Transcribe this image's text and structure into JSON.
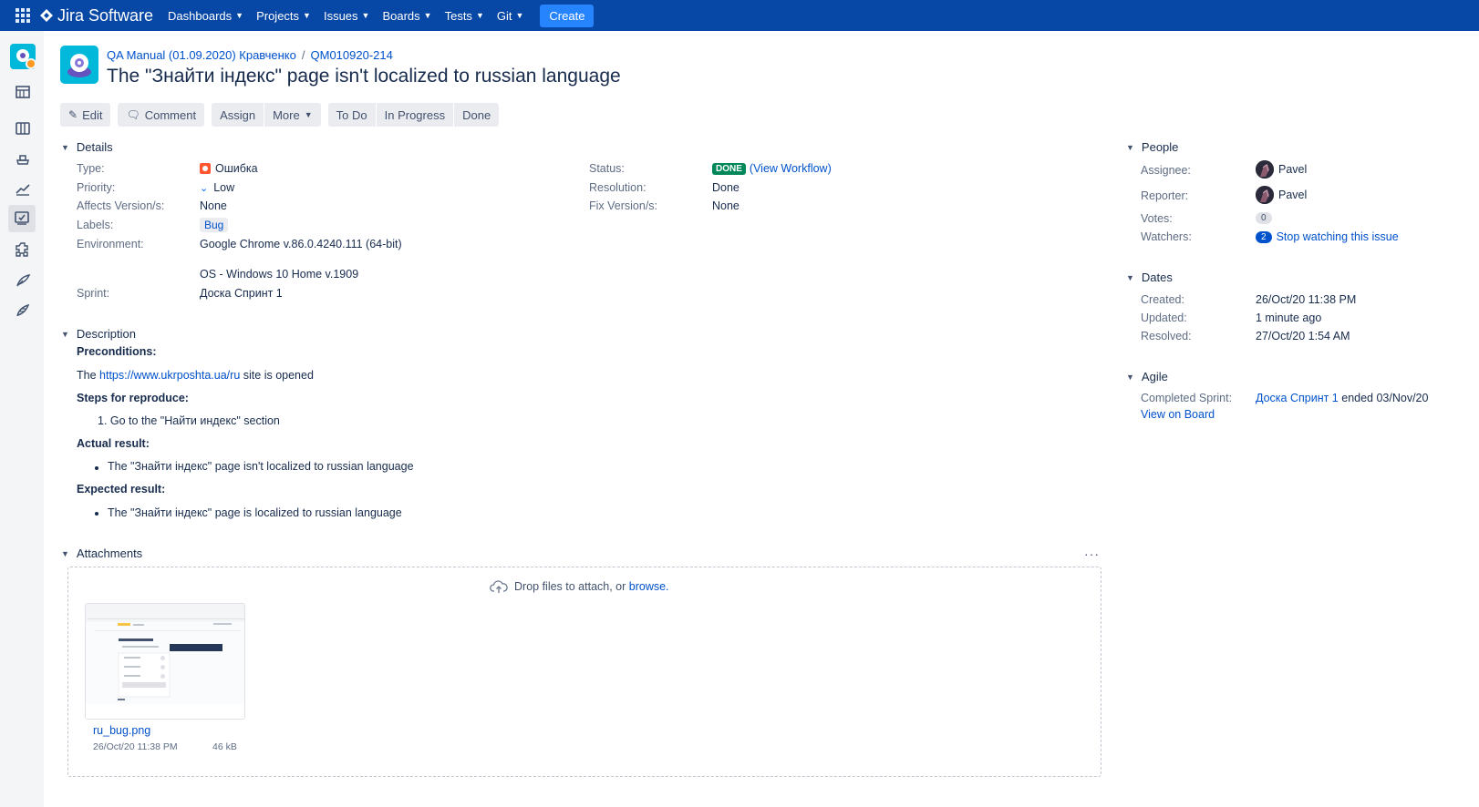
{
  "nav": {
    "product": "Jira Software",
    "items": [
      "Dashboards",
      "Projects",
      "Issues",
      "Boards",
      "Tests",
      "Git"
    ],
    "create": "Create"
  },
  "breadcrumb": {
    "project": "QA Manual (01.09.2020) Кравченко",
    "separator": "/",
    "key": "QM010920-214"
  },
  "issue": {
    "title": "The \"Знайти індекс\" page isn't localized to russian language"
  },
  "toolbar": {
    "edit": "Edit",
    "comment": "Comment",
    "assign": "Assign",
    "more": "More",
    "todo": "To Do",
    "in_progress": "In Progress",
    "done": "Done"
  },
  "details": {
    "heading": "Details",
    "type_label": "Type:",
    "type_value": "Ошибка",
    "priority_label": "Priority:",
    "priority_value": "Low",
    "affects_label": "Affects Version/s:",
    "affects_value": "None",
    "labels_label": "Labels:",
    "labels_value": "Bug",
    "environment_label": "Environment:",
    "environment_line1": "Google Chrome v.86.0.4240.111 (64-bit)",
    "environment_line2": "OS - Windows 10 Home v.1909",
    "sprint_label": "Sprint:",
    "sprint_value": "Доска Спринт 1",
    "status_label": "Status:",
    "status_value": "DONE",
    "view_workflow": "(View Workflow)",
    "resolution_label": "Resolution:",
    "resolution_value": "Done",
    "fix_label": "Fix Version/s:",
    "fix_value": "None"
  },
  "description": {
    "heading": "Description",
    "preconditions": "Preconditions:",
    "pre_before": "The",
    "pre_link": "https://www.ukrposhta.ua/ru",
    "pre_after": "site is opened",
    "steps": "Steps for reproduce:",
    "step1": "1. Go to the \"Найти индекс\" section",
    "actual": "Actual result:",
    "actual_item": "The \"Знайти індекс\" page isn't localized to russian language",
    "expected": "Expected result:",
    "expected_item": "The \"Знайти індекс\" page is localized to russian language"
  },
  "attachments": {
    "heading": "Attachments",
    "more": "···",
    "drop_text": "Drop files to attach, or",
    "browse": "browse.",
    "file_name": "ru_bug.png",
    "file_date": "26/Oct/20 11:38 PM",
    "file_size": "46 kB"
  },
  "people": {
    "heading": "People",
    "assignee_label": "Assignee:",
    "assignee": "Pavel",
    "reporter_label": "Reporter:",
    "reporter": "Pavel",
    "votes_label": "Votes:",
    "votes": "0",
    "watchers_label": "Watchers:",
    "watchers": "2",
    "stop_watching": "Stop watching this issue"
  },
  "dates": {
    "heading": "Dates",
    "created_label": "Created:",
    "created": "26/Oct/20 11:38 PM",
    "updated_label": "Updated:",
    "updated": "1 minute ago",
    "resolved_label": "Resolved:",
    "resolved": "27/Oct/20 1:54 AM"
  },
  "agile": {
    "heading": "Agile",
    "completed_label": "Completed Sprint:",
    "sprint_link": "Доска Спринт 1",
    "ended": "ended 03/Nov/20",
    "view_on_board": "View on Board"
  },
  "colors": {
    "nav_bg": "#0747a6",
    "create_btn": "#2684ff",
    "done_lozenge": "#00875a",
    "bug_icon": "#ff5630",
    "link": "#0052cc"
  }
}
